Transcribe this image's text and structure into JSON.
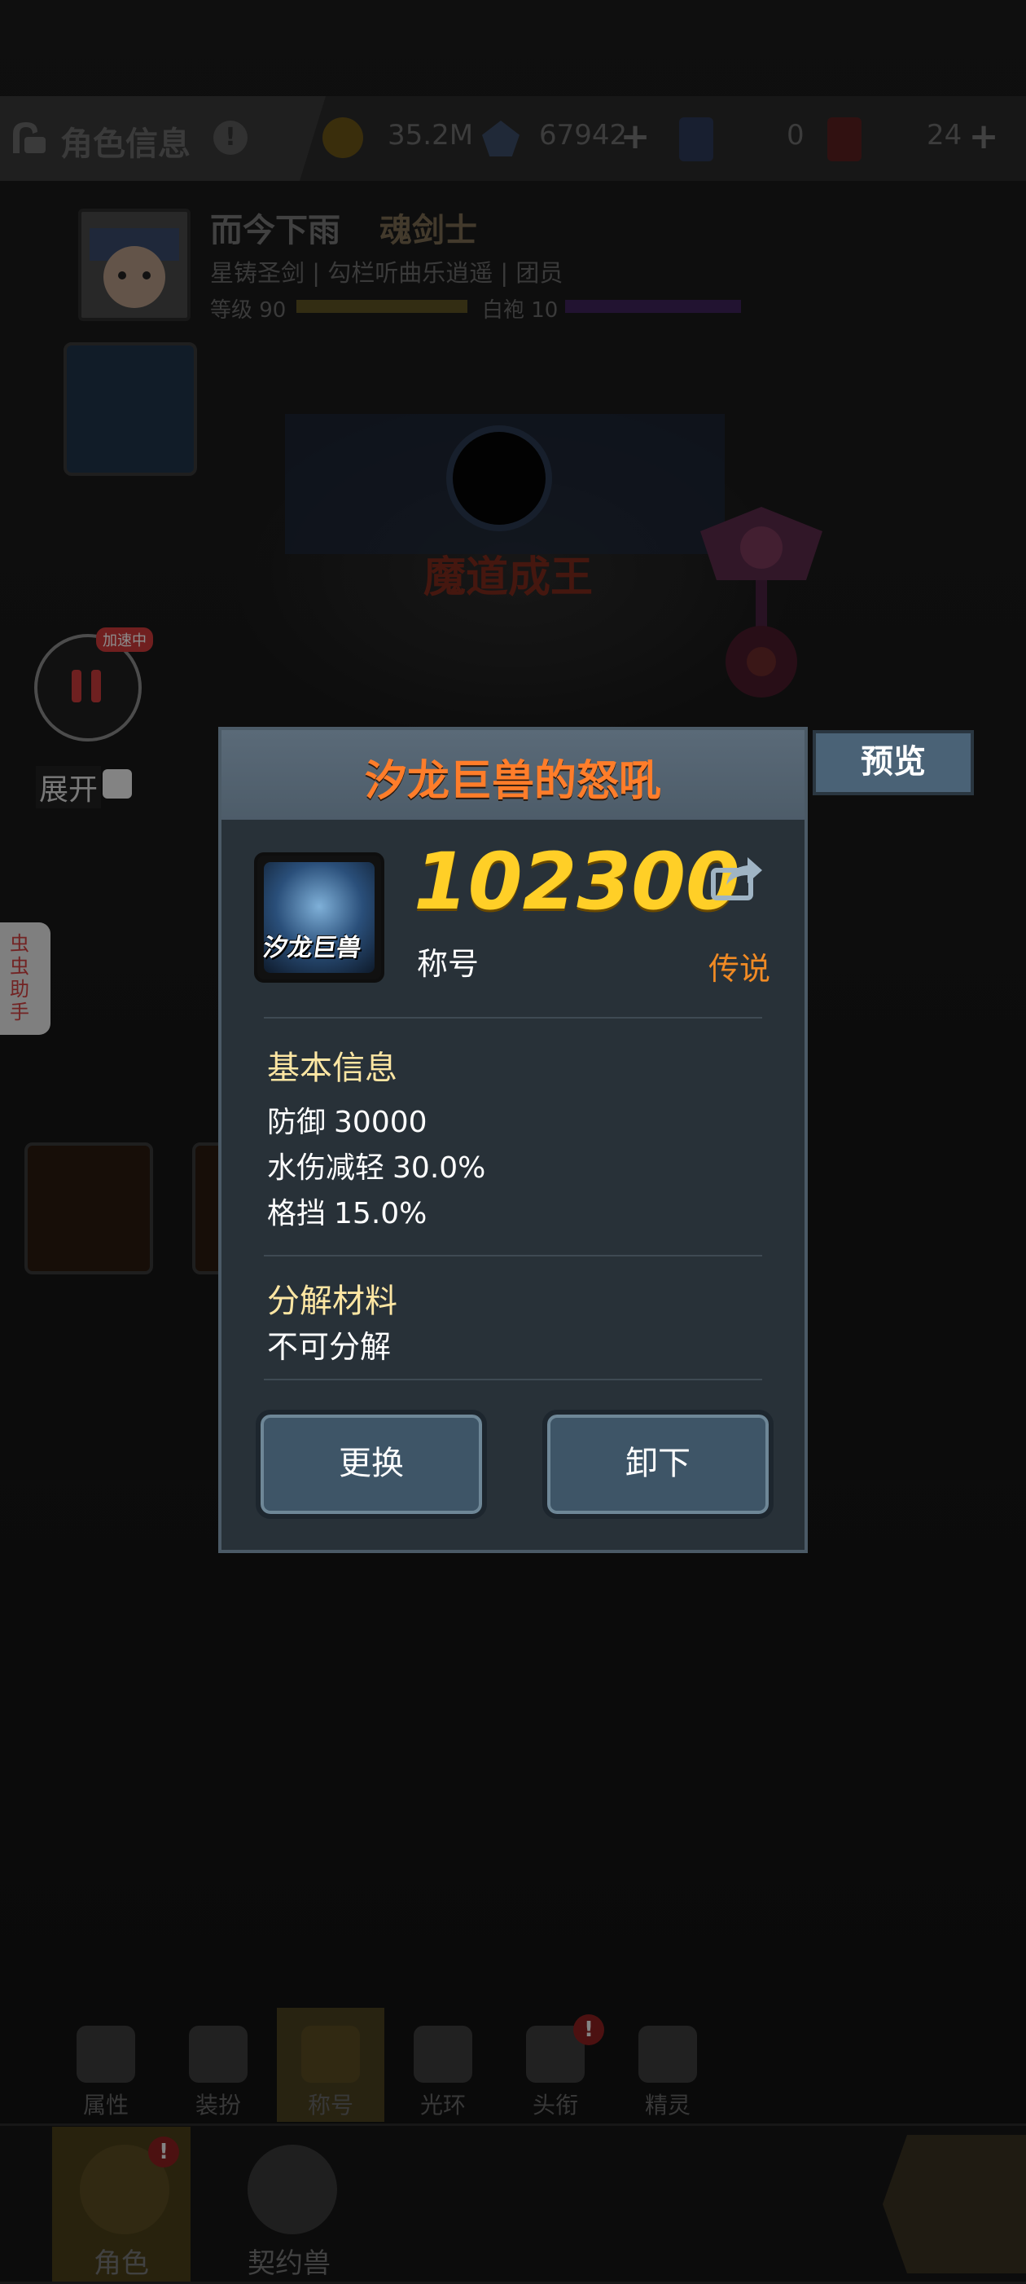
{
  "header": {
    "title": "角色信息",
    "gold": "35.2M",
    "crystals": "67942",
    "ticket_a": "0",
    "ticket_b": "24"
  },
  "profile": {
    "name": "而今下雨",
    "class": "魂剑士",
    "sub_info": "星铸圣剑 | 勾栏听曲乐逍遥 | 团员",
    "level_text": "等级 90",
    "robe_text": "白袍 10"
  },
  "scene": {
    "equipped_title_banner": "魔道成王",
    "accelerating_badge": "加速中",
    "expand_label": "展开",
    "helper_tab": "虫虫助手"
  },
  "dialog": {
    "title": "汐龙巨兽的怒吼",
    "preview_label": "预览",
    "icon_text": "汐龙巨兽",
    "power": "102300",
    "item_type": "称号",
    "rarity": "传说",
    "basic_info_title": "基本信息",
    "stats": [
      {
        "name": "防御",
        "value": "30000"
      },
      {
        "name": "水伤减轻",
        "value": "30.0%"
      },
      {
        "name": "格挡",
        "value": "15.0%"
      }
    ],
    "decompose_title": "分解材料",
    "decompose_value": "不可分解",
    "replace_label": "更换",
    "unequip_label": "卸下"
  },
  "nav": {
    "tabs": [
      {
        "label": "属性"
      },
      {
        "label": "装扮"
      },
      {
        "label": "称号"
      },
      {
        "label": "光环"
      },
      {
        "label": "头衔"
      },
      {
        "label": "精灵"
      }
    ],
    "bottom": [
      {
        "label": "角色"
      },
      {
        "label": "契约兽"
      }
    ],
    "badge_mark": "!"
  },
  "colors": {
    "dialog_title": "#ff7d2a",
    "power": "#ffcf27",
    "rarity_legendary": "#f08a24",
    "section_title": "#fde6a3"
  }
}
